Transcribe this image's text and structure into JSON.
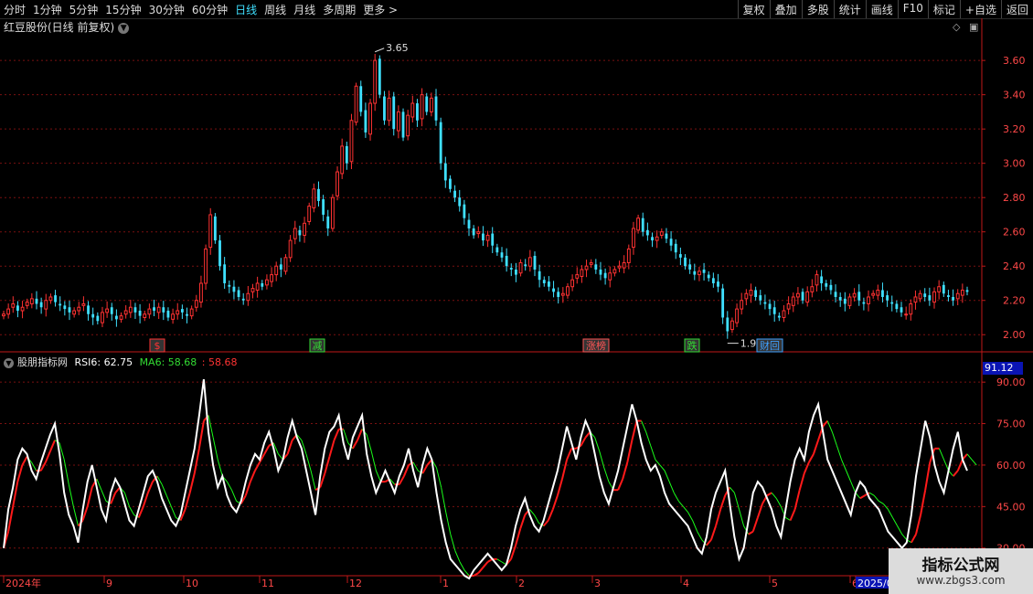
{
  "toolbar": {
    "periods": [
      {
        "label": "分时",
        "active": false
      },
      {
        "label": "1分钟",
        "active": false
      },
      {
        "label": "5分钟",
        "active": false
      },
      {
        "label": "15分钟",
        "active": false
      },
      {
        "label": "30分钟",
        "active": false
      },
      {
        "label": "60分钟",
        "active": false
      },
      {
        "label": "日线",
        "active": true
      },
      {
        "label": "周线",
        "active": false
      },
      {
        "label": "月线",
        "active": false
      },
      {
        "label": "多周期",
        "active": false
      },
      {
        "label": "更多 >",
        "active": false
      }
    ],
    "right_buttons": [
      "复权",
      "叠加",
      "多股",
      "统计",
      "画线",
      "F10",
      "标记",
      "+自选",
      "返回"
    ]
  },
  "stock_title": "红豆股份(日线 前复权)",
  "price_axis": {
    "ticks": [
      "3.60",
      "3.40",
      "3.20",
      "3.00",
      "2.80",
      "2.60",
      "2.40",
      "2.20",
      "2.00"
    ],
    "min": 1.9,
    "max": 3.75
  },
  "price_annotations": {
    "high": "3.65",
    "low": "1.93"
  },
  "event_markers": [
    {
      "label": "$",
      "color": "#ff3333"
    },
    {
      "label": "减",
      "color": "#33dd33"
    },
    {
      "label": "涨榜",
      "color": "#ff5555"
    },
    {
      "label": "跌",
      "color": "#33dd33"
    },
    {
      "label": "财回",
      "color": "#3fa0ff"
    }
  ],
  "indicator": {
    "name": "股朋指标网",
    "rsi_label": "RSI6: 62.75",
    "ma_label": "MA6: 58.68",
    "extra_label": ": 58.68",
    "badge": "91.12",
    "ticks": [
      "90.00",
      "75.00",
      "60.00",
      "45.00",
      "30.00"
    ],
    "min": 20,
    "max": 96
  },
  "date_axis": [
    "2024年",
    "9",
    "10",
    "11",
    "12",
    "1",
    "2",
    "3",
    "4",
    "5",
    "6",
    "2025/0"
  ],
  "watermark": {
    "line1": "指标公式网",
    "line2": "www.zbgs3.com"
  },
  "colors": {
    "up": "#ff3232",
    "down": "#3fe0ff",
    "rsi": "#ffffff",
    "ma_up": "#ff1a1a",
    "ma_down": "#1aff1a",
    "grid": "#7a1010",
    "axis": "#c01818"
  },
  "chart_data": [
    {
      "type": "candlestick",
      "title": "红豆股份(日线 前复权)",
      "ylim": [
        1.9,
        3.75
      ],
      "x_label_ticks": [
        "2024年",
        "9",
        "10",
        "11",
        "12",
        "1",
        "2",
        "3",
        "4",
        "5",
        "6",
        "2025/0"
      ],
      "close": [
        2.12,
        2.15,
        2.18,
        2.14,
        2.16,
        2.19,
        2.21,
        2.18,
        2.16,
        2.2,
        2.22,
        2.19,
        2.17,
        2.15,
        2.13,
        2.14,
        2.16,
        2.18,
        2.12,
        2.1,
        2.08,
        2.13,
        2.15,
        2.12,
        2.09,
        2.11,
        2.14,
        2.16,
        2.13,
        2.11,
        2.12,
        2.15,
        2.14,
        2.16,
        2.13,
        2.1,
        2.12,
        2.14,
        2.13,
        2.11,
        2.15,
        2.2,
        2.3,
        2.5,
        2.7,
        2.55,
        2.4,
        2.3,
        2.28,
        2.25,
        2.22,
        2.2,
        2.24,
        2.27,
        2.3,
        2.28,
        2.32,
        2.35,
        2.4,
        2.38,
        2.45,
        2.55,
        2.62,
        2.58,
        2.65,
        2.75,
        2.85,
        2.78,
        2.7,
        2.62,
        2.8,
        2.95,
        3.1,
        3.0,
        3.25,
        3.45,
        3.3,
        3.18,
        3.35,
        3.6,
        3.4,
        3.25,
        3.38,
        3.2,
        3.3,
        3.15,
        3.28,
        3.35,
        3.25,
        3.4,
        3.3,
        3.38,
        3.25,
        3.0,
        2.9,
        2.85,
        2.8,
        2.75,
        2.68,
        2.62,
        2.58,
        2.6,
        2.55,
        2.58,
        2.52,
        2.48,
        2.45,
        2.4,
        2.38,
        2.35,
        2.42,
        2.4,
        2.45,
        2.38,
        2.32,
        2.3,
        2.28,
        2.25,
        2.22,
        2.24,
        2.28,
        2.32,
        2.35,
        2.38,
        2.4,
        2.42,
        2.38,
        2.35,
        2.33,
        2.36,
        2.38,
        2.4,
        2.42,
        2.5,
        2.62,
        2.68,
        2.6,
        2.58,
        2.55,
        2.57,
        2.6,
        2.56,
        2.52,
        2.48,
        2.45,
        2.4,
        2.38,
        2.35,
        2.37,
        2.36,
        2.33,
        2.3,
        2.28,
        2.1,
        2.02,
        2.08,
        2.15,
        2.2,
        2.24,
        2.26,
        2.22,
        2.2,
        2.18,
        2.15,
        2.12,
        2.1,
        2.14,
        2.18,
        2.22,
        2.24,
        2.2,
        2.25,
        2.28,
        2.35,
        2.3,
        2.28,
        2.26,
        2.22,
        2.2,
        2.18,
        2.22,
        2.24,
        2.2,
        2.18,
        2.22,
        2.24,
        2.26,
        2.22,
        2.2,
        2.18,
        2.15,
        2.13,
        2.12,
        2.18,
        2.22,
        2.24,
        2.22,
        2.2,
        2.25,
        2.28,
        2.24,
        2.22,
        2.2,
        2.24,
        2.26,
        2.25
      ]
    },
    {
      "type": "line",
      "series_labels_printed": [
        "RSI6",
        "MA6"
      ],
      "ylim": [
        20,
        96
      ],
      "rsi": [
        30,
        44,
        52,
        62,
        66,
        64,
        58,
        55,
        61,
        66,
        71,
        75,
        64,
        50,
        42,
        38,
        32,
        44,
        54,
        60,
        52,
        44,
        40,
        50,
        55,
        52,
        46,
        40,
        38,
        44,
        50,
        56,
        58,
        54,
        48,
        44,
        40,
        38,
        42,
        50,
        58,
        66,
        78,
        91,
        72,
        60,
        52,
        56,
        49,
        45,
        43,
        47,
        54,
        60,
        64,
        62,
        68,
        72,
        66,
        58,
        62,
        70,
        76,
        70,
        66,
        58,
        50,
        42,
        56,
        66,
        72,
        74,
        78,
        68,
        62,
        70,
        74,
        78,
        64,
        56,
        50,
        54,
        58,
        54,
        50,
        56,
        60,
        66,
        58,
        52,
        60,
        66,
        62,
        50,
        40,
        32,
        26,
        24,
        22,
        20,
        19,
        22,
        24,
        26,
        28,
        26,
        24,
        22,
        24,
        30,
        38,
        44,
        48,
        42,
        38,
        36,
        40,
        46,
        52,
        58,
        66,
        74,
        68,
        62,
        70,
        76,
        72,
        64,
        56,
        50,
        46,
        52,
        58,
        66,
        74,
        82,
        76,
        68,
        62,
        58,
        60,
        56,
        50,
        46,
        44,
        42,
        40,
        38,
        34,
        30,
        28,
        34,
        44,
        50,
        54,
        58,
        46,
        34,
        26,
        30,
        40,
        50,
        54,
        52,
        48,
        44,
        38,
        34,
        44,
        54,
        62,
        66,
        62,
        72,
        78,
        82,
        72,
        62,
        58,
        54,
        50,
        46,
        42,
        50,
        54,
        52,
        48,
        46,
        44,
        40,
        36,
        34,
        32,
        30,
        32,
        42,
        56,
        66,
        76,
        70,
        60,
        54,
        50,
        58,
        66,
        72,
        62,
        58
      ],
      "ma": [
        30,
        36,
        45,
        54,
        60,
        63,
        61,
        58,
        58,
        61,
        65,
        69,
        68,
        62,
        53,
        45,
        38,
        40,
        45,
        52,
        55,
        51,
        47,
        46,
        50,
        52,
        50,
        45,
        42,
        41,
        45,
        50,
        54,
        56,
        53,
        49,
        45,
        41,
        40,
        44,
        50,
        57,
        66,
        76,
        78,
        70,
        62,
        56,
        54,
        51,
        47,
        46,
        49,
        54,
        58,
        61,
        64,
        67,
        68,
        64,
        62,
        64,
        69,
        71,
        69,
        64,
        58,
        51,
        52,
        57,
        63,
        69,
        73,
        73,
        68,
        66,
        69,
        73,
        71,
        65,
        58,
        54,
        54,
        55,
        53,
        53,
        56,
        60,
        61,
        58,
        57,
        60,
        62,
        59,
        52,
        43,
        35,
        29,
        25,
        22,
        20,
        20,
        21,
        23,
        25,
        26,
        26,
        25,
        24,
        26,
        31,
        37,
        42,
        44,
        42,
        39,
        38,
        40,
        44,
        49,
        55,
        62,
        66,
        66,
        67,
        70,
        72,
        70,
        65,
        59,
        54,
        51,
        51,
        55,
        61,
        69,
        76,
        76,
        72,
        67,
        62,
        60,
        58,
        54,
        50,
        47,
        45,
        43,
        40,
        36,
        33,
        31,
        33,
        38,
        44,
        49,
        52,
        50,
        44,
        38,
        35,
        36,
        41,
        46,
        49,
        50,
        48,
        45,
        41,
        40,
        44,
        51,
        57,
        61,
        64,
        69,
        74,
        76,
        72,
        67,
        62,
        58,
        54,
        50,
        48,
        49,
        50,
        49,
        47,
        46,
        44,
        41,
        38,
        35,
        33,
        32,
        35,
        42,
        51,
        61,
        66,
        66,
        62,
        58,
        56,
        58,
        62,
        64,
        62,
        60
      ]
    }
  ]
}
